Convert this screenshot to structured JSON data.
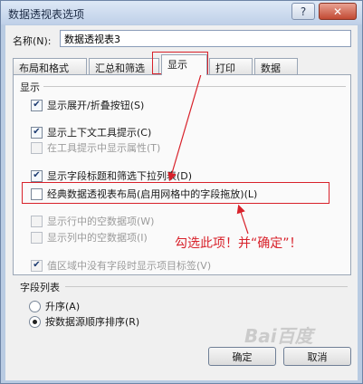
{
  "window": {
    "title": "数据透视表选项",
    "help_glyph": "?",
    "close_glyph": "✕"
  },
  "name_field": {
    "label": "名称(N):",
    "value": "数据透视表3"
  },
  "tabs": [
    {
      "label": "布局和格式",
      "active": false
    },
    {
      "label": "汇总和筛选",
      "active": false
    },
    {
      "label": "显示",
      "active": true
    },
    {
      "label": "打印",
      "active": false
    },
    {
      "label": "数据",
      "active": false
    }
  ],
  "display_group": {
    "title": "显示",
    "options": [
      {
        "label": "显示展开/折叠按钮(S)",
        "checked": true,
        "disabled": false
      },
      {
        "label": "显示上下文工具提示(C)",
        "checked": true,
        "disabled": false
      },
      {
        "label": "在工具提示中显示属性(T)",
        "checked": false,
        "disabled": true
      },
      {
        "label": "显示字段标题和筛选下拉列表(D)",
        "checked": true,
        "disabled": false
      },
      {
        "label": "经典数据透视表布局(启用网格中的字段拖放)(L)",
        "checked": false,
        "disabled": false
      },
      {
        "label": "显示行中的空数据项(W)",
        "checked": false,
        "disabled": true
      },
      {
        "label": "显示列中的空数据项(I)",
        "checked": false,
        "disabled": true
      },
      {
        "label": "值区域中没有字段时显示项目标签(V)",
        "checked": true,
        "disabled": true
      }
    ]
  },
  "field_list_group": {
    "title": "字段列表",
    "options": [
      {
        "label": "升序(A)",
        "selected": false
      },
      {
        "label": "按数据源顺序排序(R)",
        "selected": true
      }
    ]
  },
  "annotation": {
    "text": "勾选此项！并“确定”！",
    "color": "#d8212a"
  },
  "buttons": {
    "ok": "确定",
    "cancel": "取消"
  },
  "watermark": {
    "text": "Bai百度"
  },
  "check_glyph": "✔"
}
